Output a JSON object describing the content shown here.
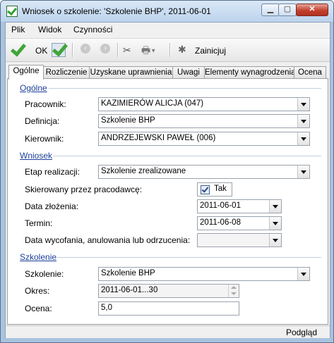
{
  "window": {
    "title": "Wniosek o szkolenie: 'Szkolenie BHP', 2011-06-01"
  },
  "menu": {
    "items": [
      "Plik",
      "Widok",
      "Czynności"
    ]
  },
  "toolbar": {
    "ok_label": "OK",
    "initiate_label": "Zainicjuj"
  },
  "tabs": [
    "Ogólne",
    "Rozliczenie",
    "Uzyskane uprawnienia",
    "Uwagi",
    "Elementy wynagrodzenia",
    "Ocena"
  ],
  "sections": {
    "ogolne": {
      "title": "Ogólne",
      "pracownik_label": "Pracownik:",
      "pracownik_value": "KAZIMIERÓW ALICJA (047)",
      "definicja_label": "Definicja:",
      "definicja_value": "Szkolenie BHP",
      "kierownik_label": "Kierownik:",
      "kierownik_value": "ANDRZEJEWSKI PAWEŁ (006)"
    },
    "wniosek": {
      "title": "Wniosek",
      "etap_label": "Etap realizacji:",
      "etap_value": "Szkolenie zrealizowane",
      "skierowany_label": "Skierowany przez pracodawcę:",
      "skierowany_value": "Tak",
      "data_zlozenia_label": "Data złożenia:",
      "data_zlozenia_value": "2011-06-01",
      "termin_label": "Termin:",
      "termin_value": "2011-06-08",
      "data_wycofania_label": "Data wycofania, anulowania lub odrzucenia:",
      "data_wycofania_value": ""
    },
    "szkolenie": {
      "title": "Szkolenie",
      "szkolenie_label": "Szkolenie:",
      "szkolenie_value": "Szkolenie BHP",
      "okres_label": "Okres:",
      "okres_value": "2011-06-01...30",
      "ocena_label": "Ocena:",
      "ocena_value": "5,0"
    }
  },
  "status": {
    "text": "Podgląd"
  }
}
